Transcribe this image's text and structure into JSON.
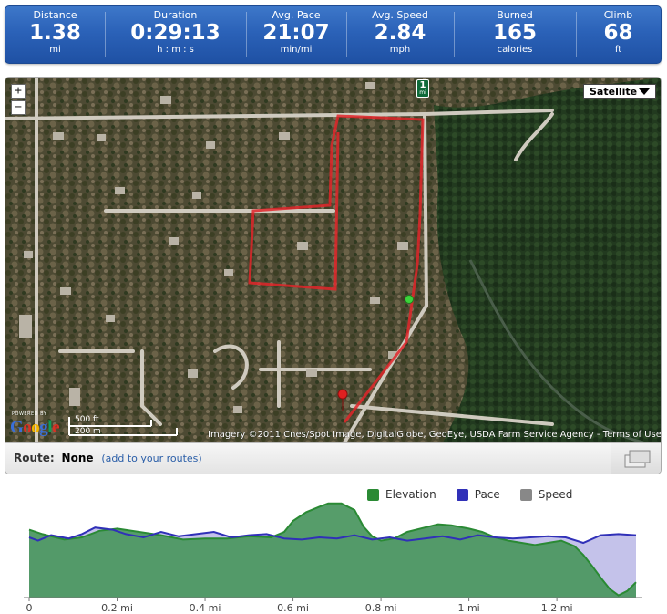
{
  "stats": [
    {
      "label": "Distance",
      "value": "1.38",
      "unit": "mi"
    },
    {
      "label": "Duration",
      "value": "0:29:13",
      "unit": "h : m : s"
    },
    {
      "label": "Avg. Pace",
      "value": "21:07",
      "unit": "min/mi"
    },
    {
      "label": "Avg. Speed",
      "value": "2.84",
      "unit": "mph"
    },
    {
      "label": "Burned",
      "value": "165",
      "unit": "calories"
    },
    {
      "label": "Climb",
      "value": "68",
      "unit": "ft"
    }
  ],
  "map": {
    "zoom_in": "+",
    "zoom_out": "−",
    "map_type": "Satellite",
    "mile_marker": {
      "number": "1",
      "unit": "mi"
    },
    "powered_by": "POWERED BY",
    "logo": "Google",
    "scale_ft": "500 ft",
    "scale_m": "200 m",
    "attribution": "Imagery ©2011 Cnes/Spot Image, DigitalGlobe, GeoEye, USDA Farm Service Agency - Terms of Use"
  },
  "route": {
    "label": "Route:",
    "value": "None",
    "add_prefix": "(",
    "add_link": "add to your routes",
    "add_suffix": ")"
  },
  "colors": {
    "elevation": "#2a8a34",
    "pace": "#3030b8",
    "speed": "#888888",
    "route": "#e0262a"
  },
  "chart_data": {
    "type": "area",
    "legend": [
      "Elevation",
      "Pace",
      "Speed"
    ],
    "xlabel": "",
    "xlim": [
      0,
      1.38
    ],
    "x_ticks": [
      "0",
      "0.2 mi",
      "0.4 mi",
      "0.6 mi",
      "0.8 mi",
      "1 mi",
      "1.2 mi"
    ],
    "series": [
      {
        "name": "Elevation",
        "x": [
          0,
          0.03,
          0.08,
          0.12,
          0.16,
          0.2,
          0.25,
          0.3,
          0.35,
          0.4,
          0.45,
          0.5,
          0.55,
          0.58,
          0.6,
          0.63,
          0.66,
          0.68,
          0.71,
          0.74,
          0.76,
          0.78,
          0.8,
          0.83,
          0.86,
          0.9,
          0.93,
          0.96,
          1.0,
          1.03,
          1.06,
          1.09,
          1.12,
          1.15,
          1.18,
          1.21,
          1.24,
          1.26,
          1.28,
          1.3,
          1.32,
          1.34,
          1.36,
          1.38
        ],
        "values": [
          62,
          58,
          53,
          55,
          61,
          63,
          60,
          57,
          53,
          54,
          54,
          56,
          55,
          60,
          70,
          78,
          83,
          86,
          86,
          80,
          65,
          56,
          52,
          54,
          60,
          64,
          67,
          66,
          63,
          60,
          55,
          52,
          50,
          48,
          50,
          52,
          47,
          39,
          29,
          18,
          8,
          2,
          6,
          14
        ]
      },
      {
        "name": "Pace",
        "x": [
          0,
          0.02,
          0.05,
          0.09,
          0.12,
          0.15,
          0.19,
          0.22,
          0.26,
          0.3,
          0.34,
          0.38,
          0.42,
          0.46,
          0.5,
          0.54,
          0.58,
          0.62,
          0.66,
          0.7,
          0.74,
          0.78,
          0.82,
          0.86,
          0.9,
          0.94,
          0.98,
          1.02,
          1.06,
          1.1,
          1.14,
          1.18,
          1.22,
          1.26,
          1.3,
          1.34,
          1.38
        ],
        "values": [
          55,
          52,
          57,
          54,
          58,
          64,
          62,
          58,
          55,
          60,
          56,
          58,
          60,
          55,
          57,
          58,
          54,
          53,
          55,
          54,
          57,
          53,
          55,
          52,
          54,
          56,
          53,
          57,
          55,
          54,
          55,
          56,
          55,
          50,
          57,
          58,
          57
        ]
      },
      {
        "name": "Speed",
        "x": [],
        "values": []
      }
    ]
  }
}
